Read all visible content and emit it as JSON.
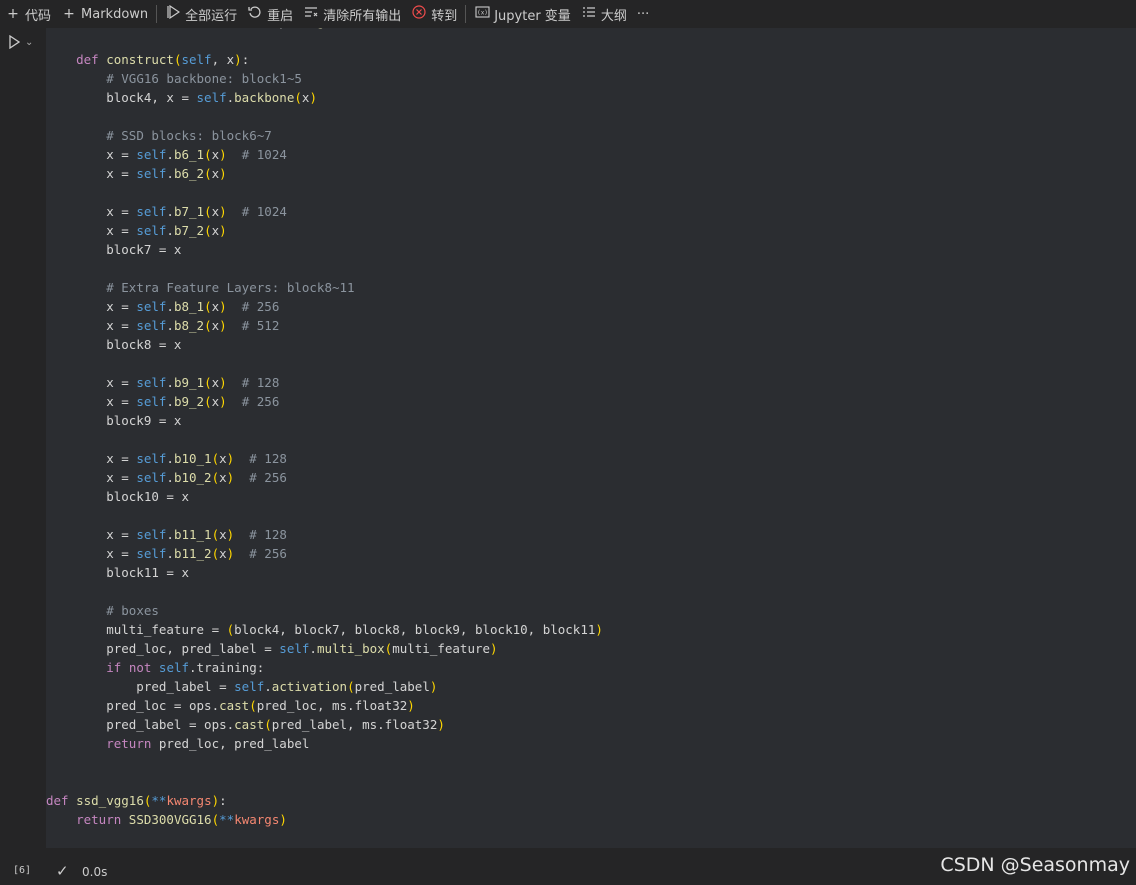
{
  "toolbar": {
    "items": [
      {
        "icon": "plus-icon",
        "label": "代码"
      },
      {
        "icon": "plus-icon",
        "label": "Markdown"
      },
      {
        "icon": "run-all-icon",
        "label": "全部运行"
      },
      {
        "icon": "restart-icon",
        "label": "重启"
      },
      {
        "icon": "clear-outputs-icon",
        "label": "清除所有输出"
      },
      {
        "icon": "interrupt-icon",
        "label": "转到"
      },
      {
        "icon": "variables-icon",
        "label": "Jupyter 变量"
      },
      {
        "icon": "outline-icon",
        "label": "大纲"
      }
    ],
    "more": "···"
  },
  "cell": {
    "execution_count": "[6]",
    "status_icon": "check-icon",
    "exec_time": "0.0s"
  },
  "code": [
    "            self.activation = ops.Sigmoid()",
    "",
    "    def construct(self, x):",
    "        # VGG16 backbone: block1~5",
    "        block4, x = self.backbone(x)",
    "",
    "        # SSD blocks: block6~7",
    "        x = self.b6_1(x)  # 1024",
    "        x = self.b6_2(x)",
    "",
    "        x = self.b7_1(x)  # 1024",
    "        x = self.b7_2(x)",
    "        block7 = x",
    "",
    "        # Extra Feature Layers: block8~11",
    "        x = self.b8_1(x)  # 256",
    "        x = self.b8_2(x)  # 512",
    "        block8 = x",
    "",
    "        x = self.b9_1(x)  # 128",
    "        x = self.b9_2(x)  # 256",
    "        block9 = x",
    "",
    "        x = self.b10_1(x)  # 128",
    "        x = self.b10_2(x)  # 256",
    "        block10 = x",
    "",
    "        x = self.b11_1(x)  # 128",
    "        x = self.b11_2(x)  # 256",
    "        block11 = x",
    "",
    "        # boxes",
    "        multi_feature = (block4, block7, block8, block9, block10, block11)",
    "        pred_loc, pred_label = self.multi_box(multi_feature)",
    "        if not self.training:",
    "            pred_label = self.activation(pred_label)",
    "        pred_loc = ops.cast(pred_loc, ms.float32)",
    "        pred_label = ops.cast(pred_label, ms.float32)",
    "        return pred_loc, pred_label",
    "",
    "",
    "def ssd_vgg16(**kwargs):",
    "    return SSD300VGG16(**kwargs)"
  ],
  "watermark": "CSDN @Seasonmay"
}
